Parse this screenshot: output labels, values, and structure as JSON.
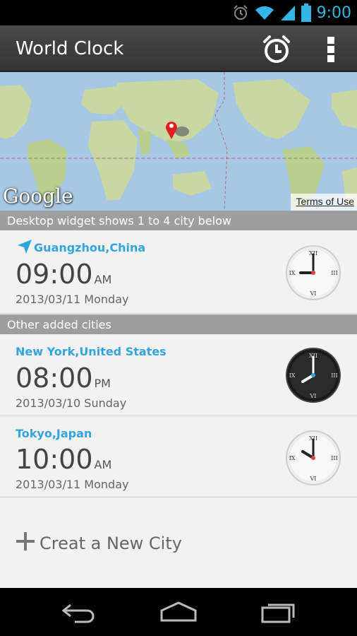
{
  "status_bar": {
    "time": "9:00",
    "icons": [
      "alarm-icon",
      "wifi-icon",
      "signal-icon",
      "battery-icon"
    ]
  },
  "app": {
    "title": "World Clock",
    "actions": [
      "alarm-clock-icon",
      "overflow-menu-icon"
    ]
  },
  "map": {
    "brand": "Google",
    "terms_link": "Terms of Use"
  },
  "sections": {
    "widget_header": "Desktop widget shows 1 to 4 city below",
    "other_header": "Other added cities"
  },
  "cities": [
    {
      "name": "Guangzhou,China",
      "time": "09:00",
      "ampm": "AM",
      "date": "2013/03/11 Monday",
      "clock_style": "light",
      "is_current_location": true
    },
    {
      "name": "New York,United States",
      "time": "08:00",
      "ampm": "PM",
      "date": "2013/03/10 Sunday",
      "clock_style": "dark",
      "is_current_location": false
    },
    {
      "name": "Tokyo,Japan",
      "time": "10:00",
      "ampm": "AM",
      "date": "2013/03/11 Monday",
      "clock_style": "light",
      "is_current_location": false
    }
  ],
  "create_city": {
    "label": "Creat a New City"
  },
  "nav_bar": {
    "buttons": [
      "back-icon",
      "home-icon",
      "recent-apps-icon"
    ]
  },
  "colors": {
    "accent": "#33a4dd",
    "status_time": "#33b5e5",
    "header_gray": "#9e9e9e",
    "action_bar": "#3c3c3c"
  }
}
